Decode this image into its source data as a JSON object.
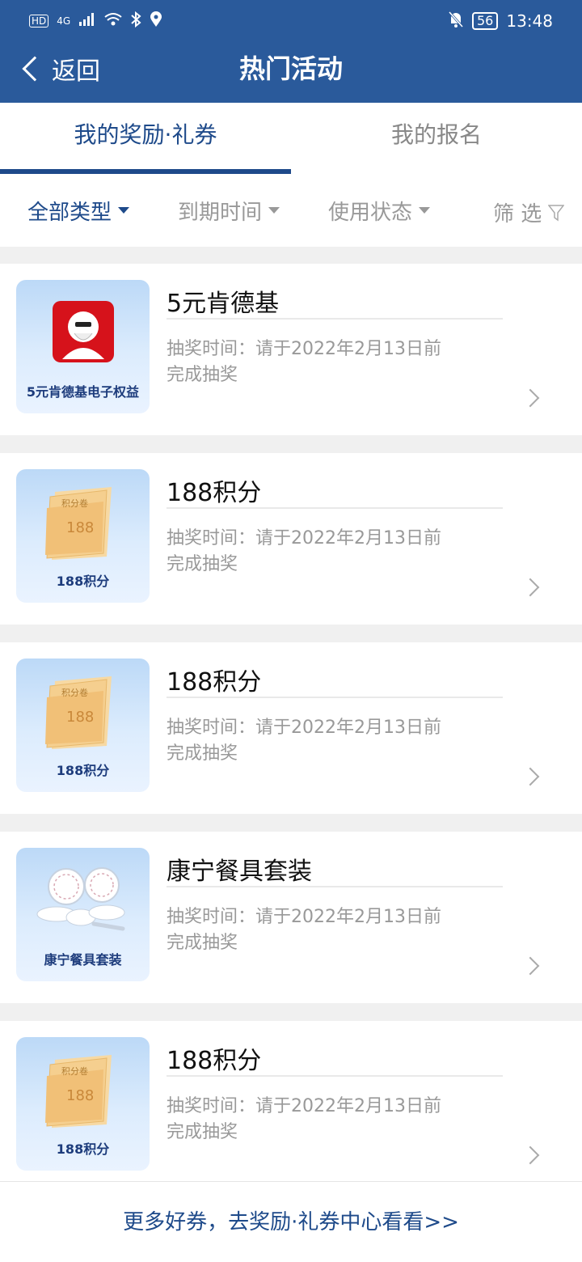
{
  "status_bar": {
    "left_icons": [
      "hd-icon",
      "signal-icon",
      "wifi-icon",
      "bluetooth-icon",
      "location-icon"
    ],
    "network": "4G",
    "battery": "56",
    "time": "13:48"
  },
  "nav": {
    "back_label": "返回",
    "title": "热门活动"
  },
  "tabs": [
    {
      "label": "我的奖励·礼券",
      "active": true
    },
    {
      "label": "我的报名",
      "active": false
    }
  ],
  "filters": [
    {
      "label": "全部类型",
      "active": true
    },
    {
      "label": "到期时间",
      "active": false
    },
    {
      "label": "使用状态",
      "active": false
    },
    {
      "label": "筛 选",
      "active": false
    }
  ],
  "items": [
    {
      "title": "5元肯德基",
      "thumb_label": "5元肯德基电子权益",
      "line1": "抽奖时间：请于2022年2月13日前",
      "line2": "完成抽奖",
      "art": "kfc"
    },
    {
      "title": "188积分",
      "thumb_label": "188积分",
      "line1": "抽奖时间：请于2022年2月13日前",
      "line2": "完成抽奖",
      "art": "points"
    },
    {
      "title": "188积分",
      "thumb_label": "188积分",
      "line1": "抽奖时间：请于2022年2月13日前",
      "line2": "完成抽奖",
      "art": "points"
    },
    {
      "title": "康宁餐具套装",
      "thumb_label": "康宁餐具套装",
      "line1": "抽奖时间：请于2022年2月13日前",
      "line2": "完成抽奖",
      "art": "dishes"
    },
    {
      "title": "188积分",
      "thumb_label": "188积分",
      "line1": "抽奖时间：请于2022年2月13日前",
      "line2": "完成抽奖",
      "art": "points"
    }
  ],
  "points_ticket": {
    "head": "积分卷",
    "number": "188"
  },
  "footer": {
    "link": "更多好券，去奖励·礼券中心看看>>"
  },
  "colors": {
    "header": "#2a5a9b",
    "accent": "#1e4a8a",
    "text_muted": "#999999"
  }
}
